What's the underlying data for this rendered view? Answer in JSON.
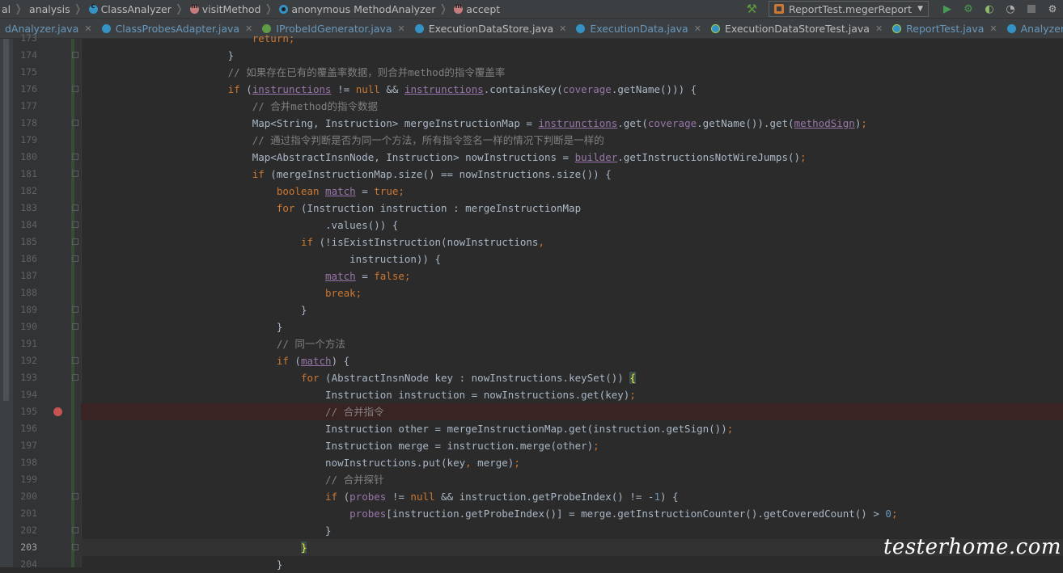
{
  "breadcrumb": {
    "items": [
      {
        "label": "al",
        "icon": "none"
      },
      {
        "label": "analysis",
        "icon": "none"
      },
      {
        "label": "ClassAnalyzer",
        "icon": "class-icon"
      },
      {
        "label": "visitMethod",
        "icon": "method-icon"
      },
      {
        "label": "anonymous MethodAnalyzer",
        "icon": "anonymous-class-icon"
      },
      {
        "label": "accept",
        "icon": "method-icon"
      }
    ]
  },
  "toolbar": {
    "run_config": "ReportTest.megerReport"
  },
  "tabs": [
    {
      "label": "dAnalyzer.java",
      "icon": "class",
      "active": false
    },
    {
      "label": "ClassProbesAdapter.java",
      "icon": "class",
      "active": false
    },
    {
      "label": "IProbeIdGenerator.java",
      "icon": "interface",
      "active": false
    },
    {
      "label": "ExecutionDataStore.java",
      "icon": "class",
      "active": false,
      "plain": true
    },
    {
      "label": "ExecutionData.java",
      "icon": "class",
      "active": false
    },
    {
      "label": "ExecutionDataStoreTest.java",
      "icon": "test",
      "active": false,
      "plain": true
    },
    {
      "label": "ReportTest.java",
      "icon": "test",
      "active": false
    },
    {
      "label": "Analyzer.java",
      "icon": "class",
      "active": false
    }
  ],
  "editor": {
    "breakpoint_line": 195,
    "current_line": 203,
    "lines": [
      {
        "n": "173",
        "tokens": [
          [
            "",
            "                            "
          ],
          [
            "kw",
            "return"
          ],
          [
            "kw",
            ";"
          ]
        ]
      },
      {
        "n": "174",
        "tokens": [
          [
            "",
            "                        }"
          ]
        ]
      },
      {
        "n": "175",
        "tokens": [
          [
            "",
            "                        "
          ],
          [
            "cm",
            "// 如果存在已有的覆盖率数据，则合并method的指令覆盖率"
          ]
        ]
      },
      {
        "n": "176",
        "tokens": [
          [
            "",
            "                        "
          ],
          [
            "kw",
            "if"
          ],
          [
            "",
            " ("
          ],
          [
            "fld ul",
            "instrunctions"
          ],
          [
            "",
            " != "
          ],
          [
            "kw",
            "null"
          ],
          [
            "",
            " && "
          ],
          [
            "fld ul",
            "instrunctions"
          ],
          [
            "",
            ".containsKey("
          ],
          [
            "fld",
            "coverage"
          ],
          [
            "",
            ".getName())) {"
          ]
        ]
      },
      {
        "n": "177",
        "tokens": [
          [
            "",
            "                            "
          ],
          [
            "cm",
            "// 合并method的指令数据"
          ]
        ]
      },
      {
        "n": "178",
        "tokens": [
          [
            "",
            "                            Map<String, Instruction> mergeInstructionMap = "
          ],
          [
            "fld ul",
            "instrunctions"
          ],
          [
            "",
            ".get("
          ],
          [
            "fld",
            "coverage"
          ],
          [
            "",
            ".getName()).get("
          ],
          [
            "fld ul",
            "methodSign"
          ],
          [
            "",
            ")"
          ],
          [
            "kw",
            ";"
          ]
        ]
      },
      {
        "n": "179",
        "tokens": [
          [
            "",
            "                            "
          ],
          [
            "cm",
            "// 通过指令判断是否为同一个方法，所有指令签名一样的情况下判断是一样的"
          ]
        ]
      },
      {
        "n": "180",
        "tokens": [
          [
            "",
            "                            Map<AbstractInsnNode, Instruction> nowInstructions = "
          ],
          [
            "fld ul",
            "builder"
          ],
          [
            "",
            ".getInstructionsNotWireJumps()"
          ],
          [
            "kw",
            ";"
          ]
        ]
      },
      {
        "n": "181",
        "tokens": [
          [
            "",
            "                            "
          ],
          [
            "kw",
            "if"
          ],
          [
            "",
            " (mergeInstructionMap.size() == nowInstructions.size()) {"
          ]
        ]
      },
      {
        "n": "182",
        "tokens": [
          [
            "",
            "                                "
          ],
          [
            "kw",
            "boolean "
          ],
          [
            "fld ul",
            "match"
          ],
          [
            "",
            " = "
          ],
          [
            "kw",
            "true;"
          ]
        ]
      },
      {
        "n": "183",
        "tokens": [
          [
            "",
            "                                "
          ],
          [
            "kw",
            "for"
          ],
          [
            "",
            " (Instruction instruction : mergeInstructionMap"
          ]
        ]
      },
      {
        "n": "184",
        "tokens": [
          [
            "",
            "                                        .values()) {"
          ]
        ]
      },
      {
        "n": "185",
        "tokens": [
          [
            "",
            "                                    "
          ],
          [
            "kw",
            "if"
          ],
          [
            "",
            " (!isExistInstruction(nowInstructions"
          ],
          [
            "kw",
            ","
          ]
        ]
      },
      {
        "n": "186",
        "tokens": [
          [
            "",
            "                                            instruction)) {"
          ]
        ]
      },
      {
        "n": "187",
        "tokens": [
          [
            "",
            "                                        "
          ],
          [
            "fld ul",
            "match"
          ],
          [
            "",
            " = "
          ],
          [
            "kw",
            "false;"
          ]
        ]
      },
      {
        "n": "188",
        "tokens": [
          [
            "",
            "                                        "
          ],
          [
            "kw",
            "break;"
          ]
        ]
      },
      {
        "n": "189",
        "tokens": [
          [
            "",
            "                                    }"
          ]
        ]
      },
      {
        "n": "190",
        "tokens": [
          [
            "",
            "                                }"
          ]
        ]
      },
      {
        "n": "191",
        "tokens": [
          [
            "",
            "                                "
          ],
          [
            "cm",
            "// 同一个方法"
          ]
        ]
      },
      {
        "n": "192",
        "tokens": [
          [
            "",
            "                                "
          ],
          [
            "kw",
            "if"
          ],
          [
            "",
            " ("
          ],
          [
            "fld ul",
            "match"
          ],
          [
            "",
            ") {"
          ]
        ]
      },
      {
        "n": "193",
        "tokens": [
          [
            "",
            "                                    "
          ],
          [
            "kw",
            "for"
          ],
          [
            "",
            " (AbstractInsnNode key : nowInstructions.keySet()) "
          ],
          [
            "brace-hl",
            "{"
          ]
        ]
      },
      {
        "n": "194",
        "tokens": [
          [
            "",
            "                                        Instruction instruction = nowInstructions.get(key)"
          ],
          [
            "kw",
            ";"
          ]
        ]
      },
      {
        "n": "195",
        "tokens": [
          [
            "",
            "                                        "
          ],
          [
            "cm",
            "// 合并指令"
          ]
        ]
      },
      {
        "n": "196",
        "tokens": [
          [
            "",
            "                                        Instruction other = mergeInstructionMap.get(instruction.getSign())"
          ],
          [
            "kw",
            ";"
          ]
        ]
      },
      {
        "n": "197",
        "tokens": [
          [
            "",
            "                                        Instruction merge = instruction.merge(other)"
          ],
          [
            "kw",
            ";"
          ]
        ]
      },
      {
        "n": "198",
        "tokens": [
          [
            "",
            "                                        nowInstructions.put(key"
          ],
          [
            "kw",
            ","
          ],
          [
            "",
            " merge)"
          ],
          [
            "kw",
            ";"
          ]
        ]
      },
      {
        "n": "199",
        "tokens": [
          [
            "",
            "                                        "
          ],
          [
            "cm",
            "// 合并探针"
          ]
        ]
      },
      {
        "n": "200",
        "tokens": [
          [
            "",
            "                                        "
          ],
          [
            "kw",
            "if"
          ],
          [
            "",
            " ("
          ],
          [
            "fld",
            "probes"
          ],
          [
            "",
            " != "
          ],
          [
            "kw",
            "null"
          ],
          [
            "",
            " && instruction.getProbeIndex() != -"
          ],
          [
            "num",
            "1"
          ],
          [
            "",
            ") {"
          ]
        ]
      },
      {
        "n": "201",
        "tokens": [
          [
            "",
            "                                            "
          ],
          [
            "fld",
            "probes"
          ],
          [
            "",
            "[instruction.getProbeIndex()] = merge.getInstructionCounter().getCoveredCount() > "
          ],
          [
            "num",
            "0"
          ],
          [
            "kw",
            ";"
          ]
        ]
      },
      {
        "n": "202",
        "tokens": [
          [
            "",
            "                                        }"
          ]
        ]
      },
      {
        "n": "203",
        "tokens": [
          [
            "",
            "                                    "
          ],
          [
            "brace-hl",
            "}"
          ]
        ]
      },
      {
        "n": "204",
        "tokens": [
          [
            "",
            "                                }"
          ]
        ]
      }
    ]
  },
  "watermark": "testerhome.com"
}
